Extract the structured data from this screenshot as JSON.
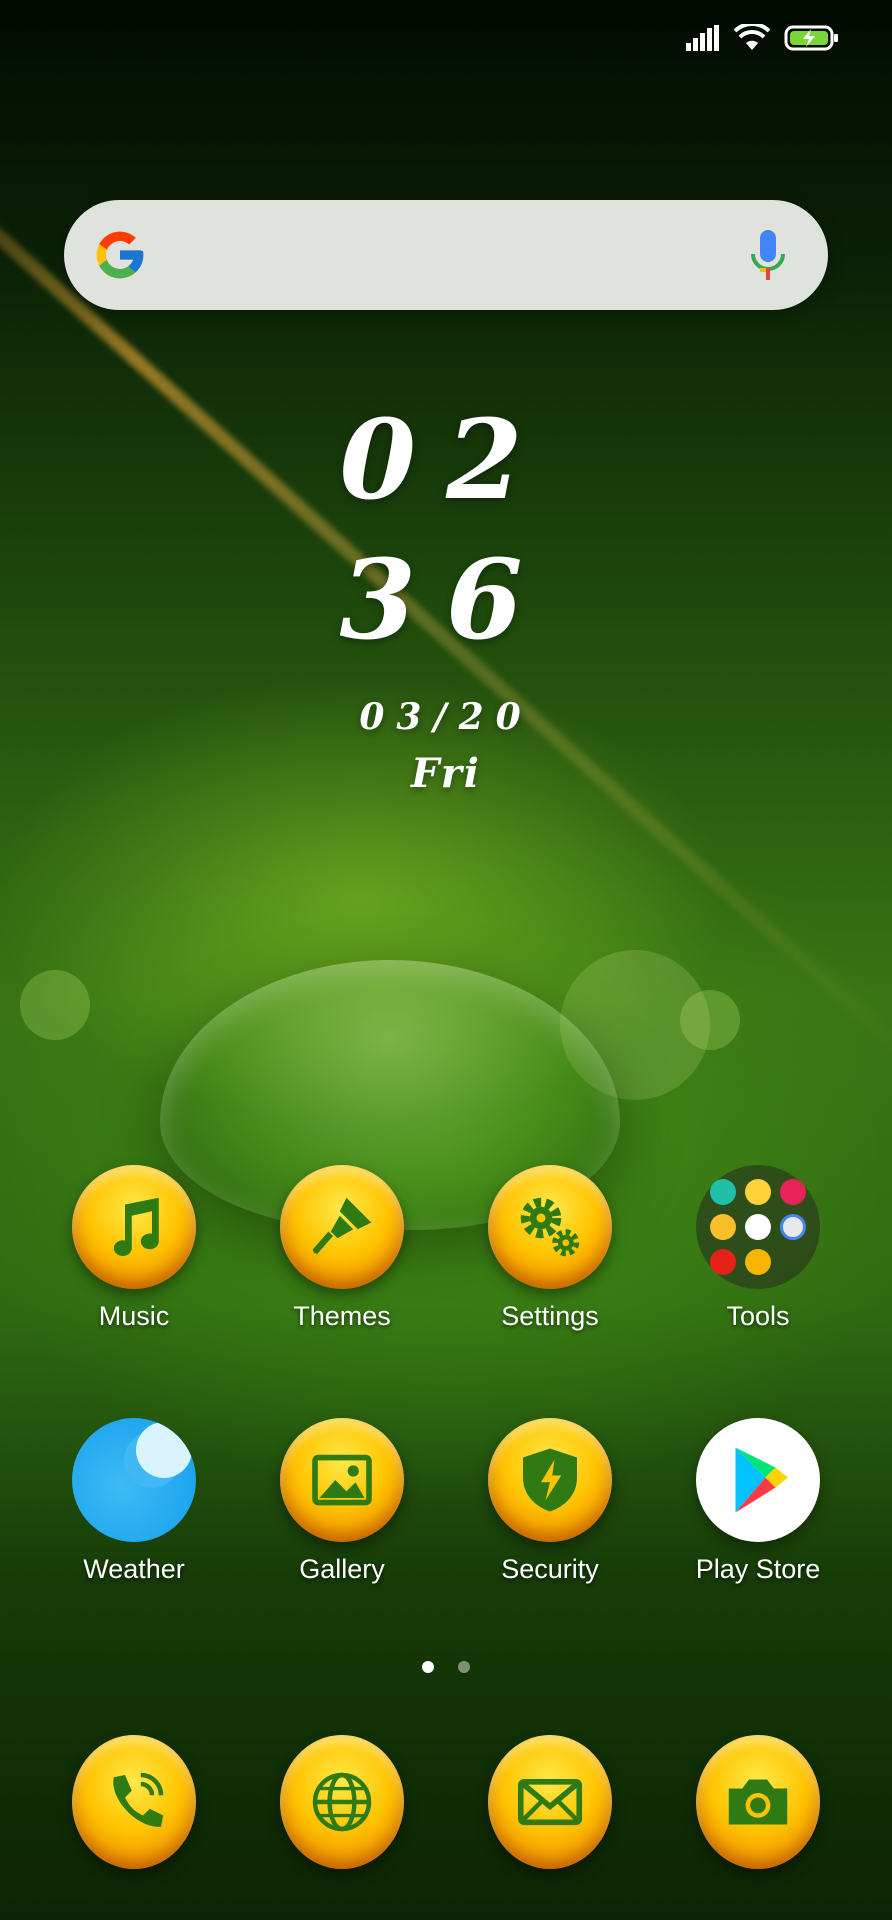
{
  "clock": {
    "hours": "02",
    "minutes": "36",
    "date": "03/20",
    "weekday": "Fri"
  },
  "apps_row1": [
    {
      "label": "Music",
      "icon": "music-note-icon"
    },
    {
      "label": "Themes",
      "icon": "paintbrush-icon"
    },
    {
      "label": "Settings",
      "icon": "gears-icon"
    },
    {
      "label": "Tools",
      "icon": "folder-icon"
    }
  ],
  "apps_row2": [
    {
      "label": "Weather",
      "icon": "weather-icon"
    },
    {
      "label": "Gallery",
      "icon": "gallery-icon"
    },
    {
      "label": "Security",
      "icon": "shield-bolt-icon"
    },
    {
      "label": "Play Store",
      "icon": "play-store-icon"
    }
  ],
  "dock": [
    {
      "icon": "phone-icon"
    },
    {
      "icon": "browser-globe-icon"
    },
    {
      "icon": "messages-envelope-icon"
    },
    {
      "icon": "camera-icon"
    }
  ],
  "page_indicator": {
    "pages": 2,
    "current": 1
  },
  "colors": {
    "orb": "#ffc400",
    "icon": "#2f7a12",
    "weather": "#1fa6ef"
  }
}
